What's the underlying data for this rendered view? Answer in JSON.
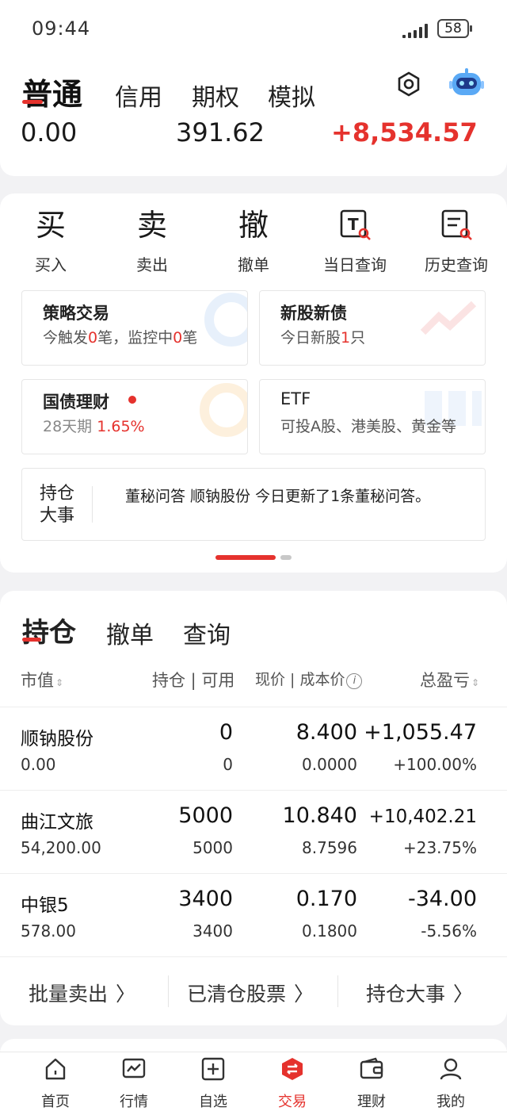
{
  "status_bar": {
    "time": "09:44",
    "battery": "58"
  },
  "account": {
    "tabs": [
      {
        "label": "普通",
        "active": true
      },
      {
        "label": "信用",
        "active": false
      },
      {
        "label": "期权",
        "active": false
      },
      {
        "label": "模拟",
        "active": false
      }
    ],
    "values": [
      "0.00",
      "391.62",
      "+8,534.57"
    ],
    "icons": [
      "settings-icon",
      "assistant-robot-icon"
    ]
  },
  "quick_actions": [
    {
      "label": "买入",
      "glyph": "买"
    },
    {
      "label": "卖出",
      "glyph": "卖"
    },
    {
      "label": "撤单",
      "glyph": "撤"
    },
    {
      "label": "当日查询",
      "glyph": "T"
    },
    {
      "label": "历史查询",
      "glyph": "≡"
    }
  ],
  "tiles": {
    "strategy": {
      "title": "策略交易",
      "sub_a": "今触发",
      "sub_b": "0",
      "sub_c": "笔，监控中",
      "sub_d": "0",
      "sub_e": "笔"
    },
    "ipo": {
      "title": "新股新债",
      "sub_a": "今日新股",
      "sub_b": "1",
      "sub_c": "只"
    },
    "bond": {
      "title": "国债理财",
      "sub_a": "28天期",
      "sub_b": "1.65%"
    },
    "etf": {
      "title": "ETF",
      "sub": "可投A股、港美股、黄金等"
    }
  },
  "holding_events": {
    "label_line1": "持仓",
    "label_line2": "大事",
    "text": "董秘问答 顺钠股份 今日更新了1条董秘问答。"
  },
  "pager": {
    "count": 2,
    "active": 1
  },
  "holdings": {
    "tabs": [
      {
        "label": "持仓",
        "active": true
      },
      {
        "label": "撤单",
        "active": false
      },
      {
        "label": "查询",
        "active": false
      }
    ],
    "headers": {
      "market_value": "市值",
      "position": "持仓 | 可用",
      "price": "现价 | 成本价",
      "pnl": "总盈亏"
    },
    "rows": [
      {
        "name": "顺钠股份",
        "market_value": "0.00",
        "position": "0",
        "available": "0",
        "price": "8.400",
        "cost": "0.0000",
        "pnl": "+1,055.47",
        "pnl_pct": "+100.00%",
        "trend": "up"
      },
      {
        "name": "曲江文旅",
        "market_value": "54,200.00",
        "position": "5000",
        "available": "5000",
        "price": "10.840",
        "cost": "8.7596",
        "pnl": "+10,402.21",
        "pnl_pct": "+23.75%",
        "trend": "up"
      },
      {
        "name": "中银5",
        "market_value": "578.00",
        "position": "3400",
        "available": "3400",
        "price": "0.170",
        "cost": "0.1800",
        "pnl": "-34.00",
        "pnl_pct": "-5.56%",
        "trend": "down"
      }
    ],
    "links": [
      "批量卖出",
      "已清仓股票",
      "持仓大事"
    ]
  },
  "bottom_nav": [
    {
      "label": "首页",
      "icon": "home-icon",
      "active": false
    },
    {
      "label": "行情",
      "icon": "market-chart-icon",
      "active": false
    },
    {
      "label": "自选",
      "icon": "watchlist-add-icon",
      "active": false
    },
    {
      "label": "交易",
      "icon": "trade-exchange-icon",
      "active": true
    },
    {
      "label": "理财",
      "icon": "wallet-icon",
      "active": false
    },
    {
      "label": "我的",
      "icon": "profile-icon",
      "active": false
    }
  ],
  "colors": {
    "up": "#e5322d",
    "down": "#0aa06e",
    "accent": "#e5322d"
  }
}
